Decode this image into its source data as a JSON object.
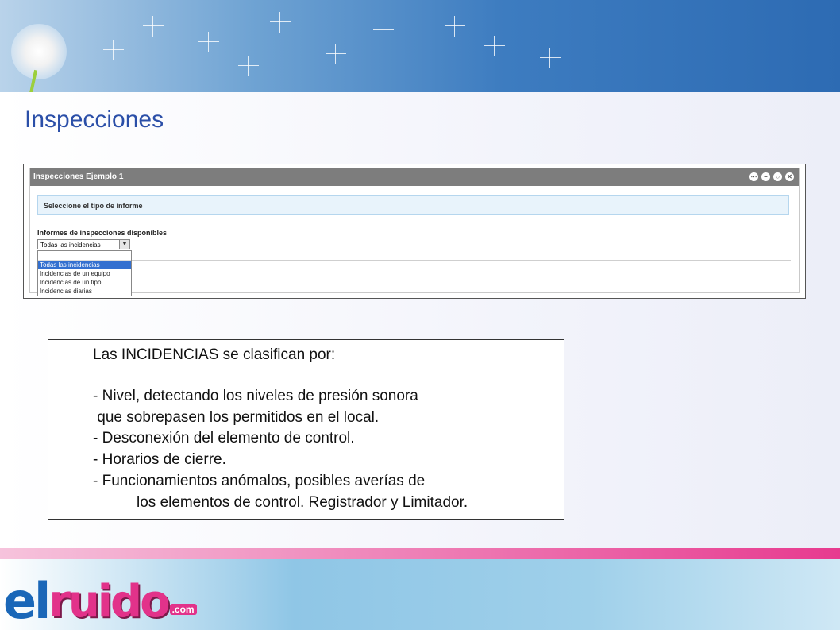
{
  "slide": {
    "title": "Inspecciones"
  },
  "window": {
    "title": "Inspecciones Ejemplo 1",
    "info_bar": "Seleccione el tipo de informe",
    "section_label": "Informes de inspecciones disponibles",
    "select_value": "Todas las incidencias",
    "options": [
      "Todas las incidencias",
      "Incidencias de un equipo",
      "Incidencias de un tipo",
      "Incidencias diarias"
    ]
  },
  "notes": {
    "lines": [
      "Las INCIDENCIAS se clasifican por:",
      "- Nivel, detectando los niveles de presión sonora",
      " que sobrepasen los permitidos en el local.",
      "- Desconexión del elemento de control.",
      "- Horarios de cierre.",
      "- Funcionamientos anómalos, posibles averías de",
      "los elementos de control. Registrador y Limitador."
    ]
  },
  "logo": {
    "el": "el",
    "ruido": "ruido",
    "com": ".com"
  },
  "colors": {
    "title": "#2b4fa8",
    "accent_pink": "#e2328a",
    "accent_blue": "#1a67b8",
    "selected_option": "#3370d0"
  }
}
